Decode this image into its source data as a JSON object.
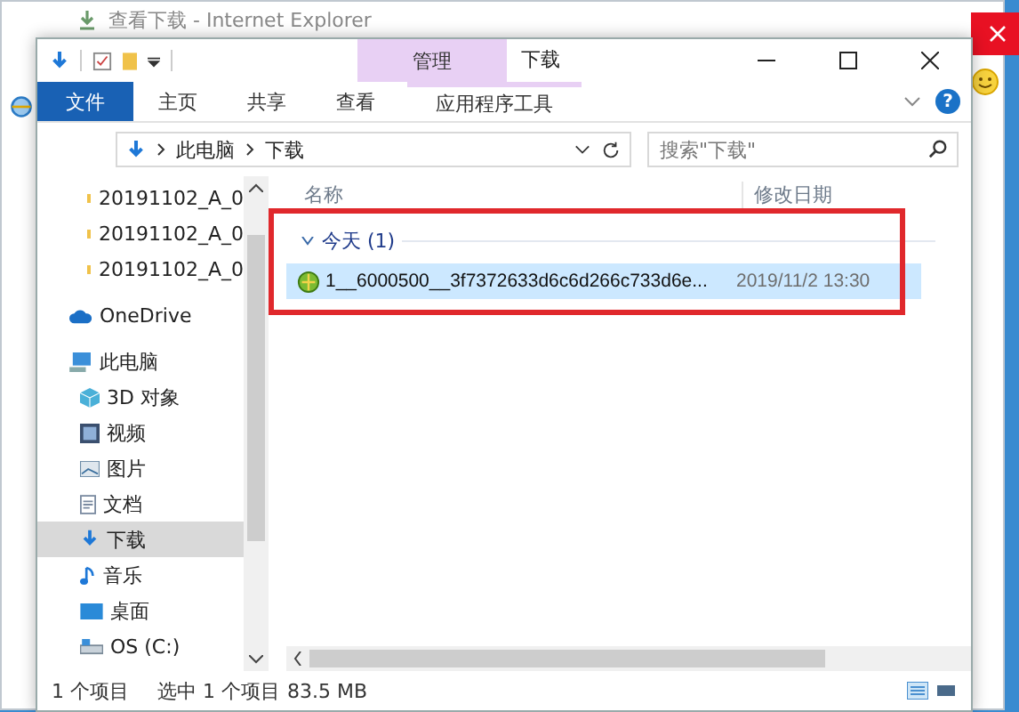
{
  "background_window": {
    "title": "查看下载 - Internet Explorer"
  },
  "explorer": {
    "context_tab": "管理",
    "title": "下载",
    "ribbon_tabs": [
      {
        "label": "文件",
        "kind": "file",
        "selected": false
      },
      {
        "label": "主页",
        "kind": "normal",
        "selected": false
      },
      {
        "label": "共享",
        "kind": "normal",
        "selected": false
      },
      {
        "label": "查看",
        "kind": "normal",
        "selected": false
      },
      {
        "label": "应用程序工具",
        "kind": "contextual",
        "selected": false
      }
    ],
    "help": "?",
    "address": {
      "path": [
        "此电脑",
        "下载"
      ]
    },
    "search": {
      "placeholder": "搜索\"下载\""
    },
    "nav_items": [
      {
        "label": "20191102_A_0",
        "kind": "folder",
        "selected": false
      },
      {
        "label": "20191102_A_0",
        "kind": "folder",
        "selected": false
      },
      {
        "label": "20191102_A_0",
        "kind": "folder",
        "selected": false
      },
      {
        "label": "OneDrive",
        "kind": "cloud",
        "selected": false
      },
      {
        "label": "此电脑",
        "kind": "pc",
        "selected": false,
        "children": [
          {
            "label": "3D 对象",
            "kind": "cube",
            "selected": false
          },
          {
            "label": "视频",
            "kind": "video",
            "selected": false
          },
          {
            "label": "图片",
            "kind": "picture",
            "selected": false
          },
          {
            "label": "文档",
            "kind": "document",
            "selected": false
          },
          {
            "label": "下载",
            "kind": "download",
            "selected": true
          },
          {
            "label": "音乐",
            "kind": "music",
            "selected": false
          },
          {
            "label": "桌面",
            "kind": "desktop",
            "selected": false
          },
          {
            "label": "OS (C:)",
            "kind": "drive",
            "selected": false
          }
        ]
      }
    ],
    "columns": [
      "名称",
      "修改日期"
    ],
    "group": {
      "label": "今天 (1)",
      "expanded": true
    },
    "files": [
      {
        "name": "1__6000500__3f7372633d6c6d266c733d6e...",
        "modified": "2019/11/2 13:30",
        "selected": true
      }
    ],
    "status": {
      "count": "1 个项目",
      "selection": "选中 1 个项目",
      "size": "83.5 MB"
    }
  }
}
